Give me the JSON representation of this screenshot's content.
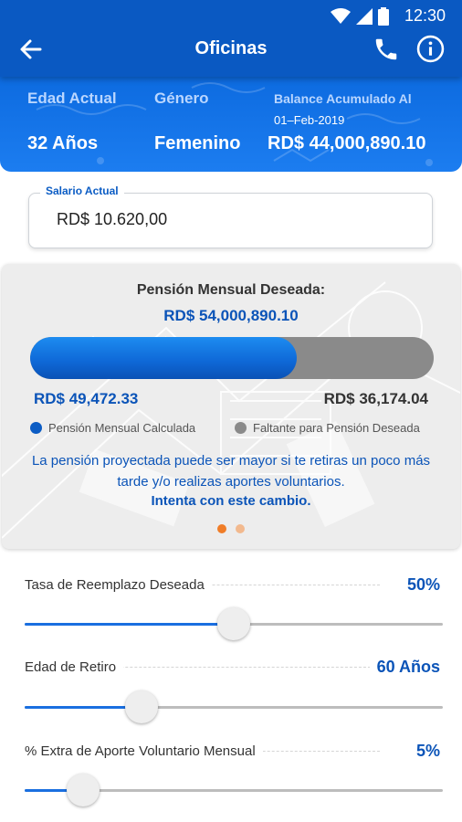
{
  "status_bar": {
    "time": "12:30",
    "icons": [
      "wifi-icon",
      "signal-icon",
      "battery-icon"
    ]
  },
  "app_bar": {
    "title": "Oficinas",
    "icons": [
      "arrow-left-icon",
      "phone-icon",
      "info-icon"
    ]
  },
  "summary": {
    "age_label": "Edad Actual",
    "age_value": "32 Años",
    "gender_label": "Género",
    "gender_value": "Femenino",
    "balance_label": "Balance Acumulado Al",
    "balance_date": "01–Feb-2019",
    "balance_value": "RD$ 44,000,890.10"
  },
  "salary": {
    "label": "Salario Actual",
    "value": "RD$ 10.620,00"
  },
  "pension_card": {
    "title": "Pensión Mensual Deseada:",
    "amount": "RD$ 54,000,890.10",
    "calculated_amount": "RD$ 49,472.33",
    "missing_amount": "RD$ 36,174.04",
    "calculated_fraction": 0.66,
    "legend_calculated": "Pensión Mensual Calculada",
    "legend_missing": "Faltante para Pensión Deseada",
    "message": "La pensión proyectada puede ser mayor si te retiras un poco más tarde y/o realizas aportes voluntarios.",
    "cta": "Intenta con este cambio.",
    "page_count": 2,
    "active_page": 1
  },
  "sliders": [
    {
      "label": "Tasa de Reemplazo Deseada",
      "value": "50%",
      "fraction": 0.5
    },
    {
      "label": "Edad de Retiro",
      "value": "60 Años",
      "fraction": 0.28
    },
    {
      "label": "% Extra de Aporte Voluntario Mensual",
      "value": "5%",
      "fraction": 0.14
    }
  ],
  "colors": {
    "primary": "#0b5cc4",
    "accent_text": "#0b54b8",
    "missing": "#8a8a8a",
    "pager_active": "#f07d28",
    "pager_inactive": "#f2b98e"
  }
}
